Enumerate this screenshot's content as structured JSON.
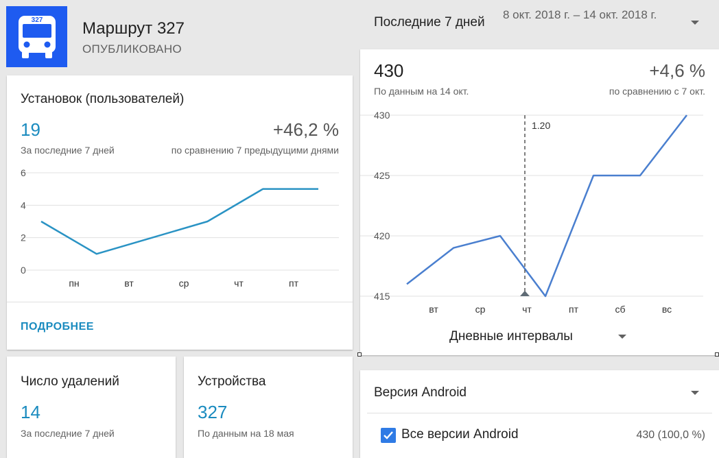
{
  "app": {
    "icon_number": "327",
    "title": "Маршрут 327",
    "status": "ОПУБЛИКОВАНО",
    "brand_color": "#1e5bf0"
  },
  "installs": {
    "title": "Установок (пользователей)",
    "value": "19",
    "value_note": "За последние 7 дней",
    "delta": "+46,2 %",
    "delta_note": "по сравнению 7 предыдущими днями",
    "more_link": "ПОДРОБНЕЕ",
    "accent_color": "#1a8bbf"
  },
  "deletions": {
    "title": "Число удалений",
    "value": "14",
    "note": "За последние 7 дней"
  },
  "devices": {
    "title": "Устройства",
    "value": "327",
    "note": "По данным на 18 мая"
  },
  "range": {
    "label": "Последние 7 дней",
    "dates": "8 окт. 2018 г. – 14 окт. 2018 г."
  },
  "users": {
    "value": "430",
    "value_note": "По данным на 14 окт.",
    "delta": "+4,6 %",
    "delta_note": "по сравнению с 7 окт.",
    "interval_label": "Дневные интервалы"
  },
  "android": {
    "title": "Версия Android",
    "row_label": "Все версии Android",
    "row_value": "430 (100,0 %)",
    "checked": true
  },
  "chart_data": [
    {
      "type": "line",
      "categories": [
        "",
        "пн",
        "",
        "вт",
        "",
        "ср",
        "",
        "чт",
        "",
        "пт",
        ""
      ],
      "series": [
        {
          "values": [
            3,
            1,
            2,
            3,
            5,
            5
          ],
          "x": [
            0,
            1,
            2,
            3,
            4,
            5
          ]
        }
      ],
      "x_labels": [
        "пн",
        "вт",
        "ср",
        "чт",
        "пт"
      ],
      "ylim": [
        0,
        6
      ],
      "yticks": [
        0,
        2,
        4,
        6
      ],
      "grid": true,
      "line_color": "#2a93c4"
    },
    {
      "type": "line",
      "x_labels": [
        "вт",
        "ср",
        "чт",
        "пт",
        "сб",
        "вс"
      ],
      "series": [
        {
          "values": [
            416,
            419,
            420,
            415,
            425,
            425,
            430
          ]
        }
      ],
      "ylim": [
        415,
        430
      ],
      "yticks": [
        415,
        420,
        425,
        430
      ],
      "grid": true,
      "annotation": {
        "label": "1.20"
      },
      "line_color": "#4a7fcf"
    }
  ]
}
